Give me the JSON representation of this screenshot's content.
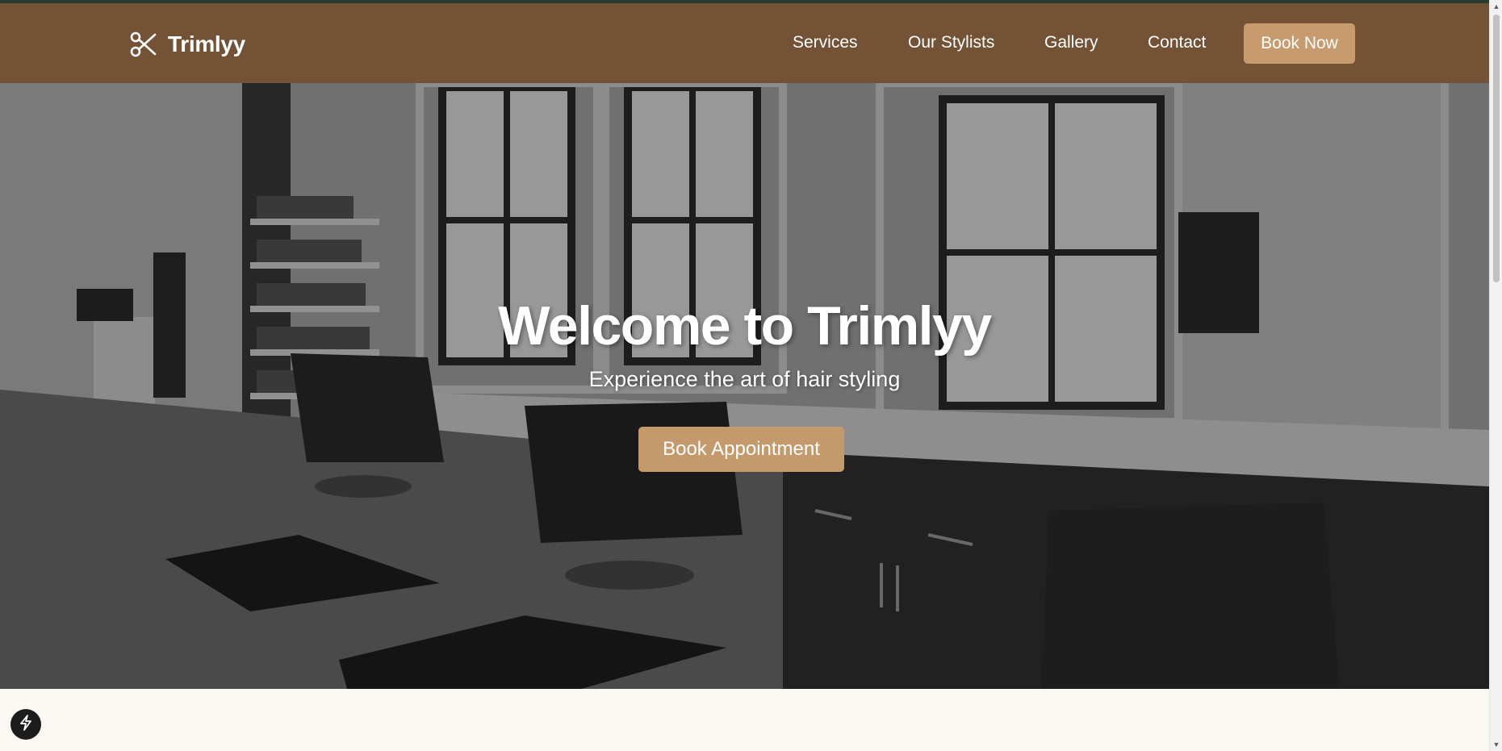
{
  "brand": {
    "name": "Trimlyy",
    "icon": "scissors-icon"
  },
  "nav": {
    "links": [
      {
        "label": "Services"
      },
      {
        "label": "Our Stylists"
      },
      {
        "label": "Gallery"
      },
      {
        "label": "Contact"
      }
    ],
    "book_label": "Book Now"
  },
  "hero": {
    "title": "Welcome to Trimlyy",
    "subtitle": "Experience the art of hair styling",
    "cta_label": "Book Appointment",
    "image": "hair-salon-interior-photo"
  },
  "colors": {
    "navbar": "#735236",
    "accent": "#c79b6e",
    "page_bg": "#fbf7f2",
    "fab": "#1c1c1c"
  },
  "fab": {
    "icon": "lightning-icon"
  }
}
